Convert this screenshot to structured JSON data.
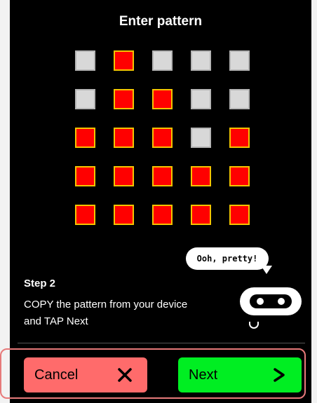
{
  "header": {
    "title": "Enter pattern"
  },
  "pattern": {
    "rows": [
      [
        false,
        true,
        false,
        false,
        false
      ],
      [
        false,
        true,
        true,
        false,
        false
      ],
      [
        true,
        true,
        true,
        false,
        true
      ],
      [
        true,
        true,
        true,
        true,
        true
      ],
      [
        true,
        true,
        true,
        true,
        true
      ]
    ],
    "on_color": "#ff0000",
    "on_border": "#f6c400",
    "off_color": "#d8d8d8"
  },
  "instructions": {
    "step": "Step 2",
    "text": "COPY the pattern from your device and TAP Next"
  },
  "mascot": {
    "speech": "Ooh, pretty!"
  },
  "footer": {
    "cancel_label": "Cancel",
    "cancel_icon": "close-icon",
    "next_label": "Next",
    "next_icon": "chevron-right-icon",
    "cancel_color": "#ff6b6b",
    "next_color": "#00ee22"
  }
}
